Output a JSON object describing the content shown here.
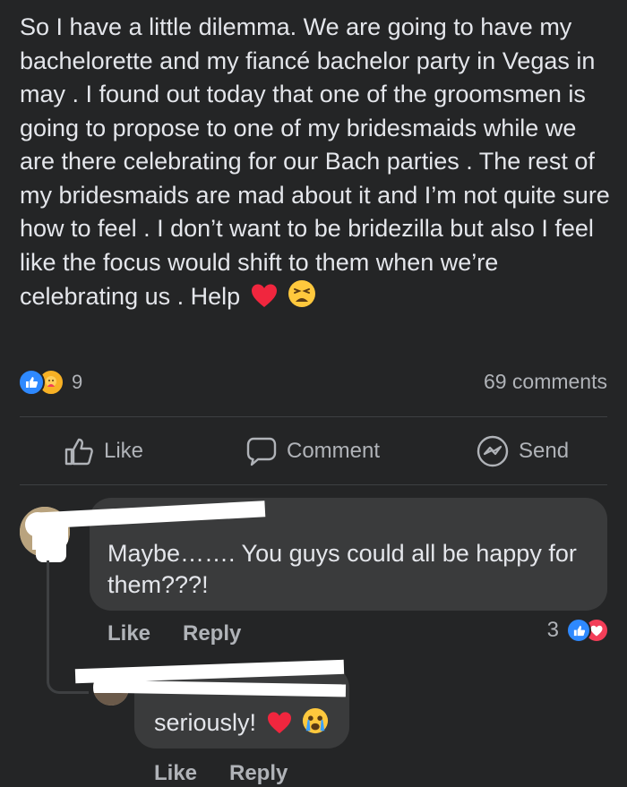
{
  "post": {
    "text": "So I have a little dilemma. We are going to have my bachelorette and my fiancé bachelor party in Vegas in may . I found out today that one of the groomsmen is going to propose to one of my bridesmaids while we are there celebrating for our Bach parties . The rest of my bridesmaids are mad about it and I’m not quite sure how to feel . I don’t want to be bridezilla but also I feel like the focus would shift to them when we’re celebrating us . Help",
    "emojis": [
      "red-heart-icon",
      "weary-face-icon"
    ]
  },
  "stats": {
    "reaction_count": "9",
    "comments": "69 comments",
    "reaction_icons": [
      "like-icon",
      "care-icon"
    ]
  },
  "actions": {
    "like": "Like",
    "comment": "Comment",
    "send": "Send"
  },
  "comments": [
    {
      "text": "Maybe……. You guys could all be happy for them???!",
      "like": "Like",
      "reply": "Reply",
      "reaction_count": "3",
      "reaction_icons": [
        "like-icon",
        "love-icon"
      ]
    },
    {
      "text": "seriously!",
      "emojis": [
        "red-heart-icon",
        "crying-face-icon"
      ],
      "like": "Like",
      "reply": "Reply"
    }
  ],
  "colors": {
    "background": "#242526",
    "bubble": "#3a3b3c",
    "text": "#e4e6eb",
    "muted": "#b0b3b8",
    "like_blue": "#2e89ff",
    "heart_red": "#f33e58"
  }
}
